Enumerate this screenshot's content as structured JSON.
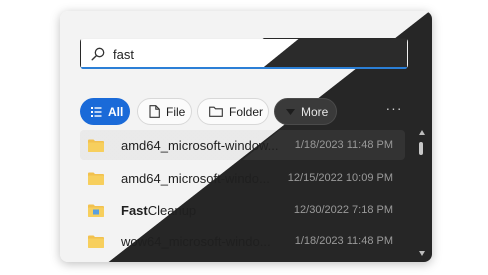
{
  "search": {
    "value": "fast",
    "icon": "search-icon"
  },
  "filters": [
    {
      "label": "All",
      "icon": "list-icon",
      "active": true
    },
    {
      "label": "File",
      "icon": "file-icon",
      "active": false
    },
    {
      "label": "Folder",
      "icon": "folder-icon",
      "active": false
    },
    {
      "label": "More",
      "icon": "caret-down-icon",
      "active": false
    }
  ],
  "more_options": "···",
  "results": [
    {
      "prefix": "",
      "name": "amd64_microsoft-window...",
      "date": "1/18/2023 11:48 PM",
      "selected": true
    },
    {
      "prefix": "",
      "name": "amd64_microsoft-windo...",
      "date": "12/15/2022 10:09 PM",
      "selected": false
    },
    {
      "prefix": "Fast",
      "name": "Cleanup",
      "date": "12/30/2022 7:18 PM",
      "selected": false
    },
    {
      "prefix": "",
      "name": "wow64_microsoft-windo...",
      "date": "1/18/2023 11:48 PM",
      "selected": false
    }
  ],
  "colors": {
    "accent": "#1a6ad8",
    "folder": "#f2c14e",
    "light_bg": "#f3f3f3",
    "dark_bg": "#262626"
  }
}
